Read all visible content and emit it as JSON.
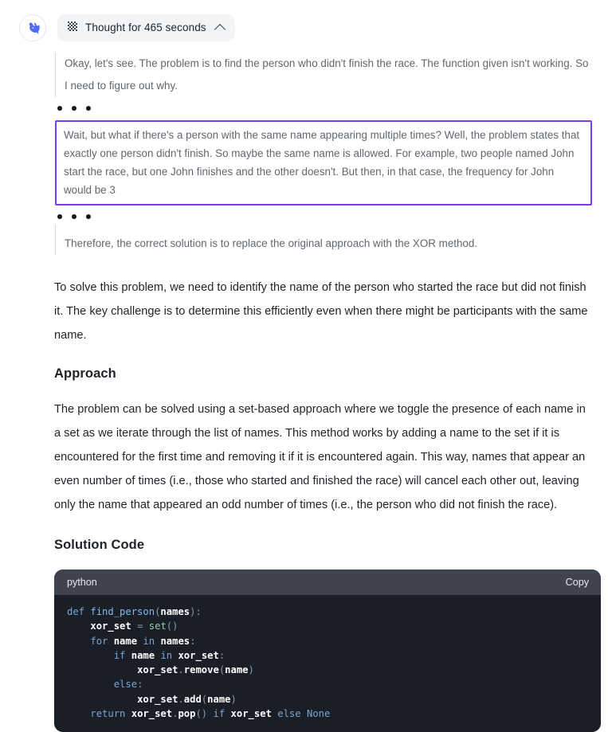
{
  "assistant": {
    "avatar_icon": "deepseek-whale-logo"
  },
  "thought_toggle": {
    "icon": "grid-pattern-icon",
    "label": "Thought for 465 seconds",
    "chevron_icon": "chevron-up-icon"
  },
  "reasoning": {
    "paragraph_1": "Okay, let's see. The problem is to find the person who didn't finish the race. The function given isn't working. So I need to figure out why.",
    "highlighted_paragraph": "Wait, but what if there's a person with the same name appearing multiple times? Well, the problem states that exactly one person didn't finish. So maybe the same name is allowed. For example, two people named John start the race, but one John finishes and the other doesn't. But then, in that case, the frequency for John would be 3",
    "paragraph_2": "Therefore, the correct solution is to replace the original approach with the XOR method.",
    "highlight_color": "#7c3aed",
    "ellipsis": "• • •"
  },
  "answer": {
    "intro": "To solve this problem, we need to identify the name of the person who started the race but did not finish it. The key challenge is to determine this efficiently even when there might be participants with the same name.",
    "approach_heading": "Approach",
    "approach_body": "The problem can be solved using a set-based approach where we toggle the presence of each name in a set as we iterate through the list of names. This method works by adding a name to the set if it is encountered for the first time and removing it if it is encountered again. This way, names that appear an even number of times (i.e., those who started and finished the race) will cancel each other out, leaving only the name that appeared an odd number of times (i.e., the person who did not finish the race).",
    "solution_heading": "Solution Code"
  },
  "code_block": {
    "language": "python",
    "copy_label": "Copy",
    "lines": [
      "def find_person(names):",
      "    xor_set = set()",
      "    for name in names:",
      "        if name in xor_set:",
      "            xor_set.remove(name)",
      "        else:",
      "            xor_set.add(name)",
      "    return xor_set.pop() if xor_set else None"
    ],
    "header_bg": "#3f4350",
    "body_bg": "#1a1e27"
  }
}
